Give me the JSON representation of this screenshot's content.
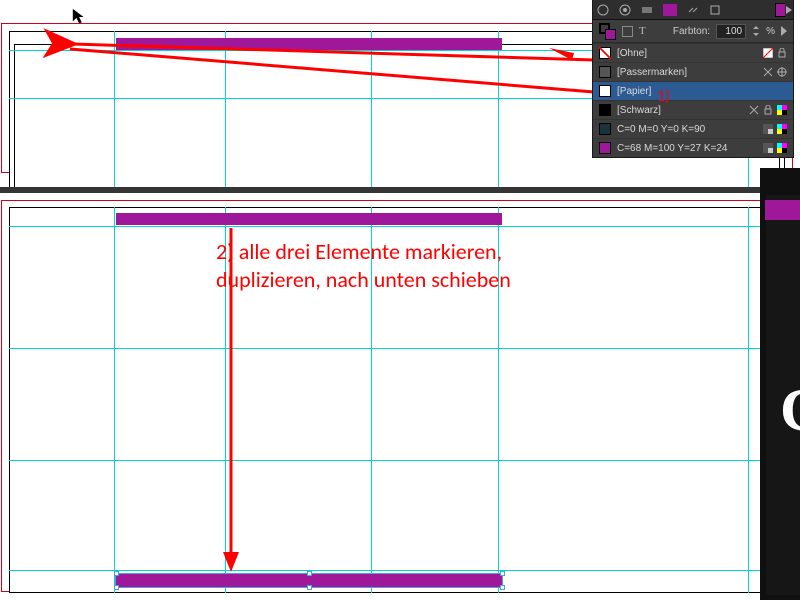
{
  "panel": {
    "tint_label": "Farbton:",
    "tint_value": "100",
    "tint_unit": "%",
    "swatches": [
      {
        "name": "[Ohne]",
        "type": "none",
        "locked": true,
        "nodelete": true
      },
      {
        "name": "[Passermarken]",
        "type": "reg",
        "locked": true,
        "nodelete": true
      },
      {
        "name": "[Papier]",
        "type": "paper",
        "selected": true
      },
      {
        "name": "[Schwarz]",
        "type": "black",
        "locked": true,
        "nodelete": true,
        "cmyk": true
      },
      {
        "name": "C=0 M=0 Y=0 K=90",
        "type": "cmyk1",
        "cmyk": true,
        "global": true
      },
      {
        "name": "C=68 M=100 Y=27 K=24",
        "type": "magenta",
        "cmyk": true,
        "global": true
      }
    ]
  },
  "annotations": {
    "step1": "1)",
    "step2_line1": "2) alle drei Elemente markieren,",
    "step2_line2": "duplizieren, nach unten schieben"
  },
  "colors": {
    "accent": "#a0189a",
    "annotation": "#ff0000",
    "guide": "#00d5d5"
  }
}
